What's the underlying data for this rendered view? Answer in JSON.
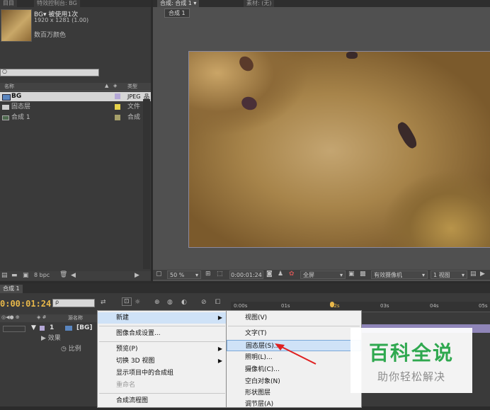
{
  "project_panel": {
    "tabs": [
      "目目",
      "特效控制台: BG"
    ],
    "preview_name": "BG▾  被使用1次",
    "preview_size": "1920 x 1281 (1.00)",
    "preview_color": "数百万颜色",
    "search_icon": "magnifier-icon",
    "col_name": "名称",
    "col_type": "类型",
    "items": [
      {
        "name": "BG",
        "type": "JPEG",
        "color": "#b4a7d6",
        "selected": true
      },
      {
        "name": "固态层",
        "type": "文件",
        "color": "#e6d24a"
      },
      {
        "name": "合成 1",
        "type": "合成",
        "color": "#a6a06a"
      }
    ],
    "bpc": "8 bpc"
  },
  "comp_panel": {
    "tabs": [
      "合成: 合成 1 ▾",
      "素材: (无)"
    ],
    "breadcrumb": "合成 1",
    "zoom": "50 %",
    "timecode": "0:00:01:24",
    "resolution": "全屏",
    "camera": "有效摄像机",
    "views": "1 视图"
  },
  "timeline": {
    "tab": "合成 1",
    "timecode": "0:00:01:24",
    "search_placeholder": "ρ",
    "col_source": "源名称",
    "layer_num": "1",
    "layer_name": "[BG]",
    "effects_label": "效果",
    "scale_label": "比例",
    "ruler": [
      "0:00s",
      "01s",
      "02s",
      "03s",
      "04s",
      "05s"
    ]
  },
  "context_menu": {
    "items": [
      {
        "label": "新建",
        "submenu": true,
        "highlight": true
      },
      {
        "label": "图像合成设置..."
      },
      {
        "label": "预览(P)",
        "submenu": true
      },
      {
        "label": "切换 3D 视图",
        "submenu": true
      },
      {
        "label": "显示项目中的合成组"
      },
      {
        "label": "重命名",
        "disabled": true
      },
      {
        "label": "合成流程图"
      }
    ]
  },
  "submenu": {
    "items": [
      {
        "label": "视图(V)"
      },
      {
        "label": "文字(T)"
      },
      {
        "label": "固态层(S)...",
        "highlight": true
      },
      {
        "label": "照明(L)..."
      },
      {
        "label": "摄像机(C)..."
      },
      {
        "label": "空白对象(N)"
      },
      {
        "label": "形状图层"
      },
      {
        "label": "调节层(A)"
      }
    ]
  },
  "watermark": {
    "title": "百科全说",
    "subtitle": "助你轻松解决"
  }
}
